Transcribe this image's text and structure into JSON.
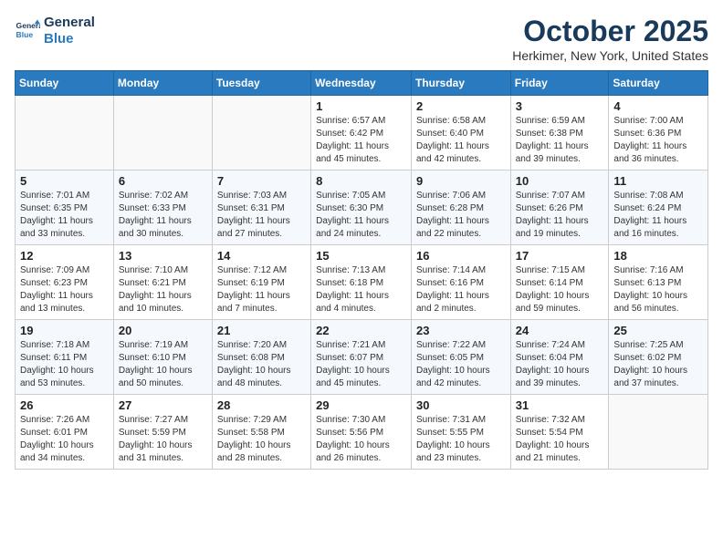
{
  "logo": {
    "line1": "General",
    "line2": "Blue"
  },
  "title": "October 2025",
  "location": "Herkimer, New York, United States",
  "weekdays": [
    "Sunday",
    "Monday",
    "Tuesday",
    "Wednesday",
    "Thursday",
    "Friday",
    "Saturday"
  ],
  "weeks": [
    [
      {
        "day": "",
        "info": ""
      },
      {
        "day": "",
        "info": ""
      },
      {
        "day": "",
        "info": ""
      },
      {
        "day": "1",
        "info": "Sunrise: 6:57 AM\nSunset: 6:42 PM\nDaylight: 11 hours and 45 minutes."
      },
      {
        "day": "2",
        "info": "Sunrise: 6:58 AM\nSunset: 6:40 PM\nDaylight: 11 hours and 42 minutes."
      },
      {
        "day": "3",
        "info": "Sunrise: 6:59 AM\nSunset: 6:38 PM\nDaylight: 11 hours and 39 minutes."
      },
      {
        "day": "4",
        "info": "Sunrise: 7:00 AM\nSunset: 6:36 PM\nDaylight: 11 hours and 36 minutes."
      }
    ],
    [
      {
        "day": "5",
        "info": "Sunrise: 7:01 AM\nSunset: 6:35 PM\nDaylight: 11 hours and 33 minutes."
      },
      {
        "day": "6",
        "info": "Sunrise: 7:02 AM\nSunset: 6:33 PM\nDaylight: 11 hours and 30 minutes."
      },
      {
        "day": "7",
        "info": "Sunrise: 7:03 AM\nSunset: 6:31 PM\nDaylight: 11 hours and 27 minutes."
      },
      {
        "day": "8",
        "info": "Sunrise: 7:05 AM\nSunset: 6:30 PM\nDaylight: 11 hours and 24 minutes."
      },
      {
        "day": "9",
        "info": "Sunrise: 7:06 AM\nSunset: 6:28 PM\nDaylight: 11 hours and 22 minutes."
      },
      {
        "day": "10",
        "info": "Sunrise: 7:07 AM\nSunset: 6:26 PM\nDaylight: 11 hours and 19 minutes."
      },
      {
        "day": "11",
        "info": "Sunrise: 7:08 AM\nSunset: 6:24 PM\nDaylight: 11 hours and 16 minutes."
      }
    ],
    [
      {
        "day": "12",
        "info": "Sunrise: 7:09 AM\nSunset: 6:23 PM\nDaylight: 11 hours and 13 minutes."
      },
      {
        "day": "13",
        "info": "Sunrise: 7:10 AM\nSunset: 6:21 PM\nDaylight: 11 hours and 10 minutes."
      },
      {
        "day": "14",
        "info": "Sunrise: 7:12 AM\nSunset: 6:19 PM\nDaylight: 11 hours and 7 minutes."
      },
      {
        "day": "15",
        "info": "Sunrise: 7:13 AM\nSunset: 6:18 PM\nDaylight: 11 hours and 4 minutes."
      },
      {
        "day": "16",
        "info": "Sunrise: 7:14 AM\nSunset: 6:16 PM\nDaylight: 11 hours and 2 minutes."
      },
      {
        "day": "17",
        "info": "Sunrise: 7:15 AM\nSunset: 6:14 PM\nDaylight: 10 hours and 59 minutes."
      },
      {
        "day": "18",
        "info": "Sunrise: 7:16 AM\nSunset: 6:13 PM\nDaylight: 10 hours and 56 minutes."
      }
    ],
    [
      {
        "day": "19",
        "info": "Sunrise: 7:18 AM\nSunset: 6:11 PM\nDaylight: 10 hours and 53 minutes."
      },
      {
        "day": "20",
        "info": "Sunrise: 7:19 AM\nSunset: 6:10 PM\nDaylight: 10 hours and 50 minutes."
      },
      {
        "day": "21",
        "info": "Sunrise: 7:20 AM\nSunset: 6:08 PM\nDaylight: 10 hours and 48 minutes."
      },
      {
        "day": "22",
        "info": "Sunrise: 7:21 AM\nSunset: 6:07 PM\nDaylight: 10 hours and 45 minutes."
      },
      {
        "day": "23",
        "info": "Sunrise: 7:22 AM\nSunset: 6:05 PM\nDaylight: 10 hours and 42 minutes."
      },
      {
        "day": "24",
        "info": "Sunrise: 7:24 AM\nSunset: 6:04 PM\nDaylight: 10 hours and 39 minutes."
      },
      {
        "day": "25",
        "info": "Sunrise: 7:25 AM\nSunset: 6:02 PM\nDaylight: 10 hours and 37 minutes."
      }
    ],
    [
      {
        "day": "26",
        "info": "Sunrise: 7:26 AM\nSunset: 6:01 PM\nDaylight: 10 hours and 34 minutes."
      },
      {
        "day": "27",
        "info": "Sunrise: 7:27 AM\nSunset: 5:59 PM\nDaylight: 10 hours and 31 minutes."
      },
      {
        "day": "28",
        "info": "Sunrise: 7:29 AM\nSunset: 5:58 PM\nDaylight: 10 hours and 28 minutes."
      },
      {
        "day": "29",
        "info": "Sunrise: 7:30 AM\nSunset: 5:56 PM\nDaylight: 10 hours and 26 minutes."
      },
      {
        "day": "30",
        "info": "Sunrise: 7:31 AM\nSunset: 5:55 PM\nDaylight: 10 hours and 23 minutes."
      },
      {
        "day": "31",
        "info": "Sunrise: 7:32 AM\nSunset: 5:54 PM\nDaylight: 10 hours and 21 minutes."
      },
      {
        "day": "",
        "info": ""
      }
    ]
  ]
}
